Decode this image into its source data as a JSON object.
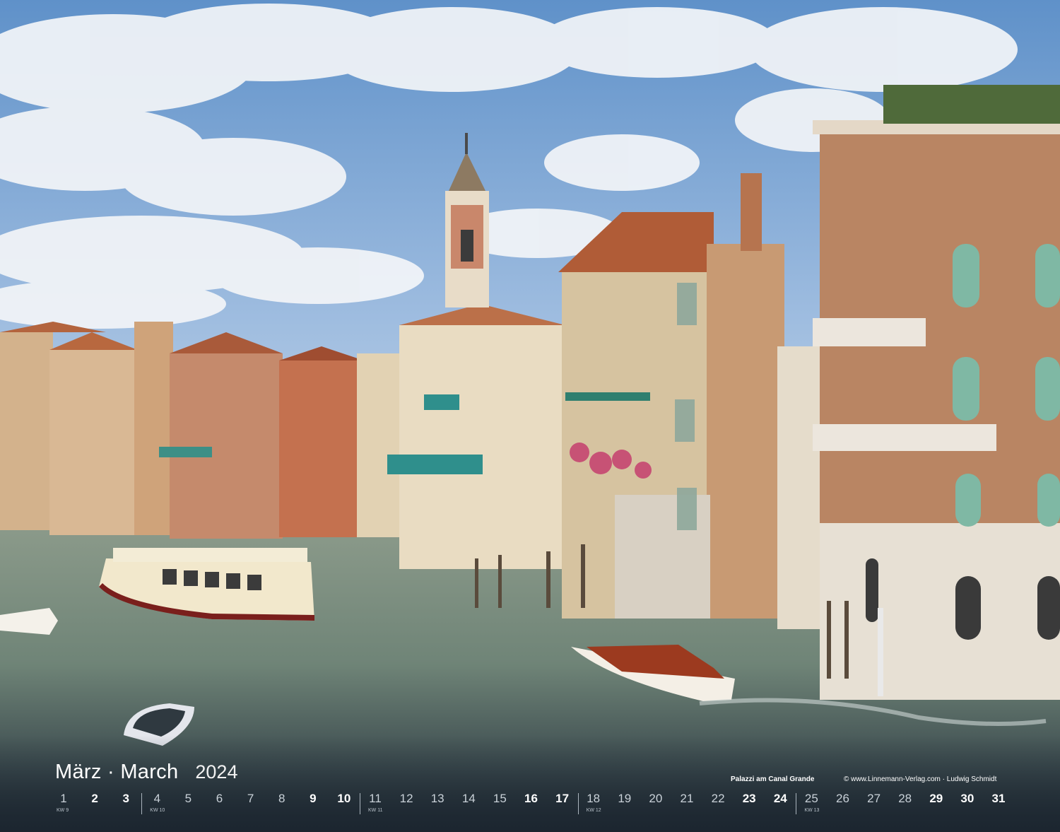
{
  "calendar": {
    "month": "März · March",
    "year": "2024",
    "caption_title": "Palazzi am Canal Grande",
    "caption_credit": "© www.Linnemann-Verlag.com · Ludwig Schmidt",
    "days": [
      {
        "label": "1",
        "weekend": false
      },
      {
        "label": "2",
        "weekend": true
      },
      {
        "label": "3",
        "weekend": true
      },
      {
        "label": "4",
        "weekend": false
      },
      {
        "label": "5",
        "weekend": false
      },
      {
        "label": "6",
        "weekend": false
      },
      {
        "label": "7",
        "weekend": false
      },
      {
        "label": "8",
        "weekend": false
      },
      {
        "label": "9",
        "weekend": true
      },
      {
        "label": "10",
        "weekend": true
      },
      {
        "label": "11",
        "weekend": false
      },
      {
        "label": "12",
        "weekend": false
      },
      {
        "label": "13",
        "weekend": false
      },
      {
        "label": "14",
        "weekend": false
      },
      {
        "label": "15",
        "weekend": false
      },
      {
        "label": "16",
        "weekend": true
      },
      {
        "label": "17",
        "weekend": true
      },
      {
        "label": "18",
        "weekend": false
      },
      {
        "label": "19",
        "weekend": false
      },
      {
        "label": "20",
        "weekend": false
      },
      {
        "label": "21",
        "weekend": false
      },
      {
        "label": "22",
        "weekend": false
      },
      {
        "label": "23",
        "weekend": true
      },
      {
        "label": "24",
        "weekend": true
      },
      {
        "label": "25",
        "weekend": false
      },
      {
        "label": "26",
        "weekend": false
      },
      {
        "label": "27",
        "weekend": false
      },
      {
        "label": "28",
        "weekend": false
      },
      {
        "label": "29",
        "weekend": true
      },
      {
        "label": "30",
        "weekend": true
      },
      {
        "label": "31",
        "weekend": true
      }
    ],
    "weeks": [
      {
        "label": "KW 9",
        "first_day_index": 0
      },
      {
        "label": "KW 10",
        "first_day_index": 3
      },
      {
        "label": "KW 11",
        "first_day_index": 10
      },
      {
        "label": "KW 12",
        "first_day_index": 17
      },
      {
        "label": "KW 13",
        "first_day_index": 24
      }
    ]
  },
  "colors": {
    "sky": "#7ea7d2",
    "water": "#7f9386",
    "dark_bottom": "#1c2630",
    "weekend_text": "#ffffff",
    "weekday_text": "#c9d1d8"
  }
}
